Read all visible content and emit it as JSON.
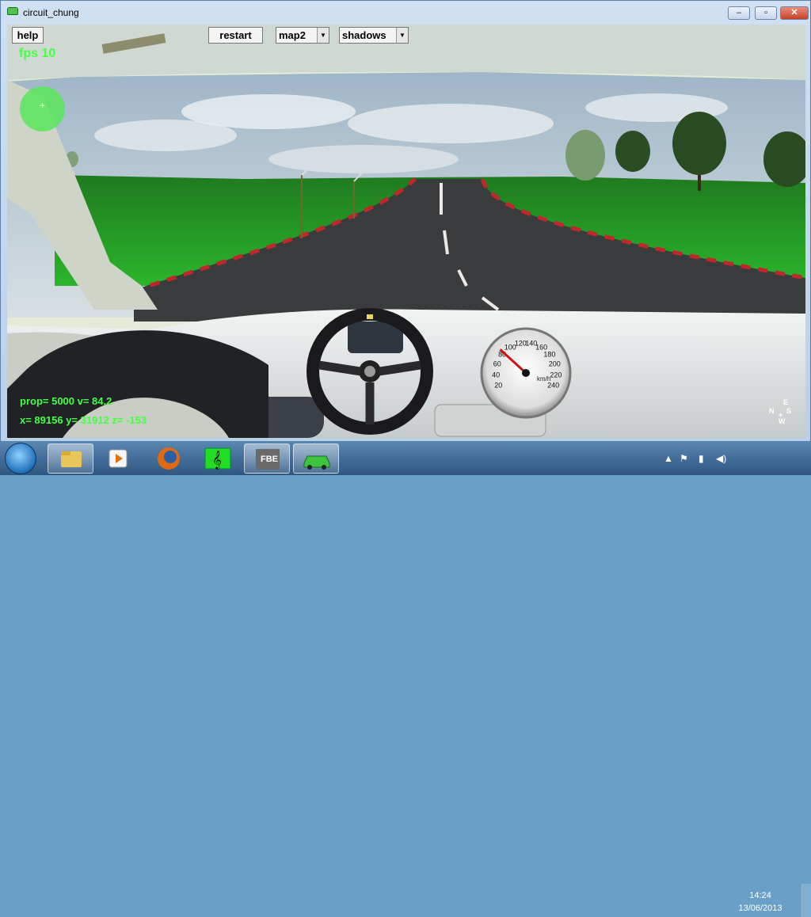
{
  "window": {
    "title": "circuit_chung",
    "minimize": "–",
    "maximize": "▫",
    "close": "✕"
  },
  "toolbar": {
    "help_label": "help",
    "restart_label": "restart",
    "map_select": {
      "value": "map2"
    },
    "shadows_select": {
      "value": "shadows"
    }
  },
  "hud": {
    "fps": "fps 10",
    "telemetry_line1": "prop= 5000  v= 84.2",
    "telemetry_line2": "x= 89156  y= 31912  z= -153",
    "radar_marker": "+",
    "compass": {
      "n": "N",
      "e": "E",
      "s": "S",
      "w": "W",
      "center": "+"
    },
    "hud_color": "#44ff44"
  },
  "speedometer": {
    "unit": "km/h",
    "ticks": [
      "20",
      "40",
      "60",
      "80",
      "100",
      "120",
      "140",
      "160",
      "180",
      "200",
      "220",
      "240"
    ],
    "current_speed": 84.2
  },
  "taskbar": {
    "items": [
      {
        "name": "windows-explorer-icon",
        "active": true
      },
      {
        "name": "media-player-icon",
        "active": false
      },
      {
        "name": "firefox-icon",
        "active": false
      },
      {
        "name": "music-app-icon",
        "active": false
      },
      {
        "name": "fbe-app-icon",
        "label": "FBE",
        "active": true
      },
      {
        "name": "car-app-icon",
        "active": true
      }
    ],
    "clock_time": "14:24",
    "clock_date": "13/06/2013"
  }
}
